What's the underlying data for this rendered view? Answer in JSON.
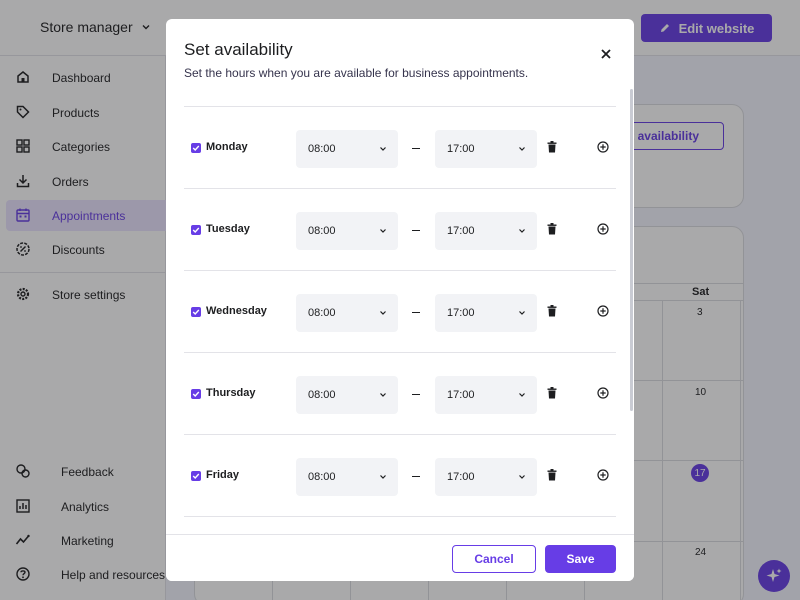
{
  "app": {
    "store_switcher": "Store manager",
    "edit_website": "Edit website",
    "set_availability_bg": "t availability"
  },
  "sidebar": {
    "items": [
      {
        "label": "Dashboard",
        "icon": "home-icon"
      },
      {
        "label": "Products",
        "icon": "tag-icon"
      },
      {
        "label": "Categories",
        "icon": "grid-icon"
      },
      {
        "label": "Orders",
        "icon": "download-icon"
      },
      {
        "label": "Appointments",
        "icon": "calendar-icon",
        "active": true
      },
      {
        "label": "Discounts",
        "icon": "discount-icon"
      },
      {
        "label": "Store settings",
        "icon": "gear-icon"
      }
    ],
    "lower": [
      {
        "label": "Feedback",
        "icon": "feedback-icon"
      },
      {
        "label": "Analytics",
        "icon": "analytics-icon"
      },
      {
        "label": "Marketing",
        "icon": "marketing-icon"
      },
      {
        "label": "Help and resources",
        "icon": "help-icon"
      }
    ]
  },
  "calendar": {
    "weekday": "Sat",
    "dates": [
      "3",
      "10",
      "17",
      "24"
    ],
    "today": "17"
  },
  "modal": {
    "title": "Set availability",
    "subtitle": "Set the hours when you are available for business appointments.",
    "days": [
      {
        "name": "Monday",
        "checked": true,
        "from": "08:00",
        "to": "17:00"
      },
      {
        "name": "Tuesday",
        "checked": true,
        "from": "08:00",
        "to": "17:00"
      },
      {
        "name": "Wednesday",
        "checked": true,
        "from": "08:00",
        "to": "17:00"
      },
      {
        "name": "Thursday",
        "checked": true,
        "from": "08:00",
        "to": "17:00"
      },
      {
        "name": "Friday",
        "checked": true,
        "from": "08:00",
        "to": "17:00"
      }
    ],
    "cancel": "Cancel",
    "save": "Save"
  },
  "colors": {
    "accent": "#673de6",
    "accent_light": "#ebe4ff"
  }
}
